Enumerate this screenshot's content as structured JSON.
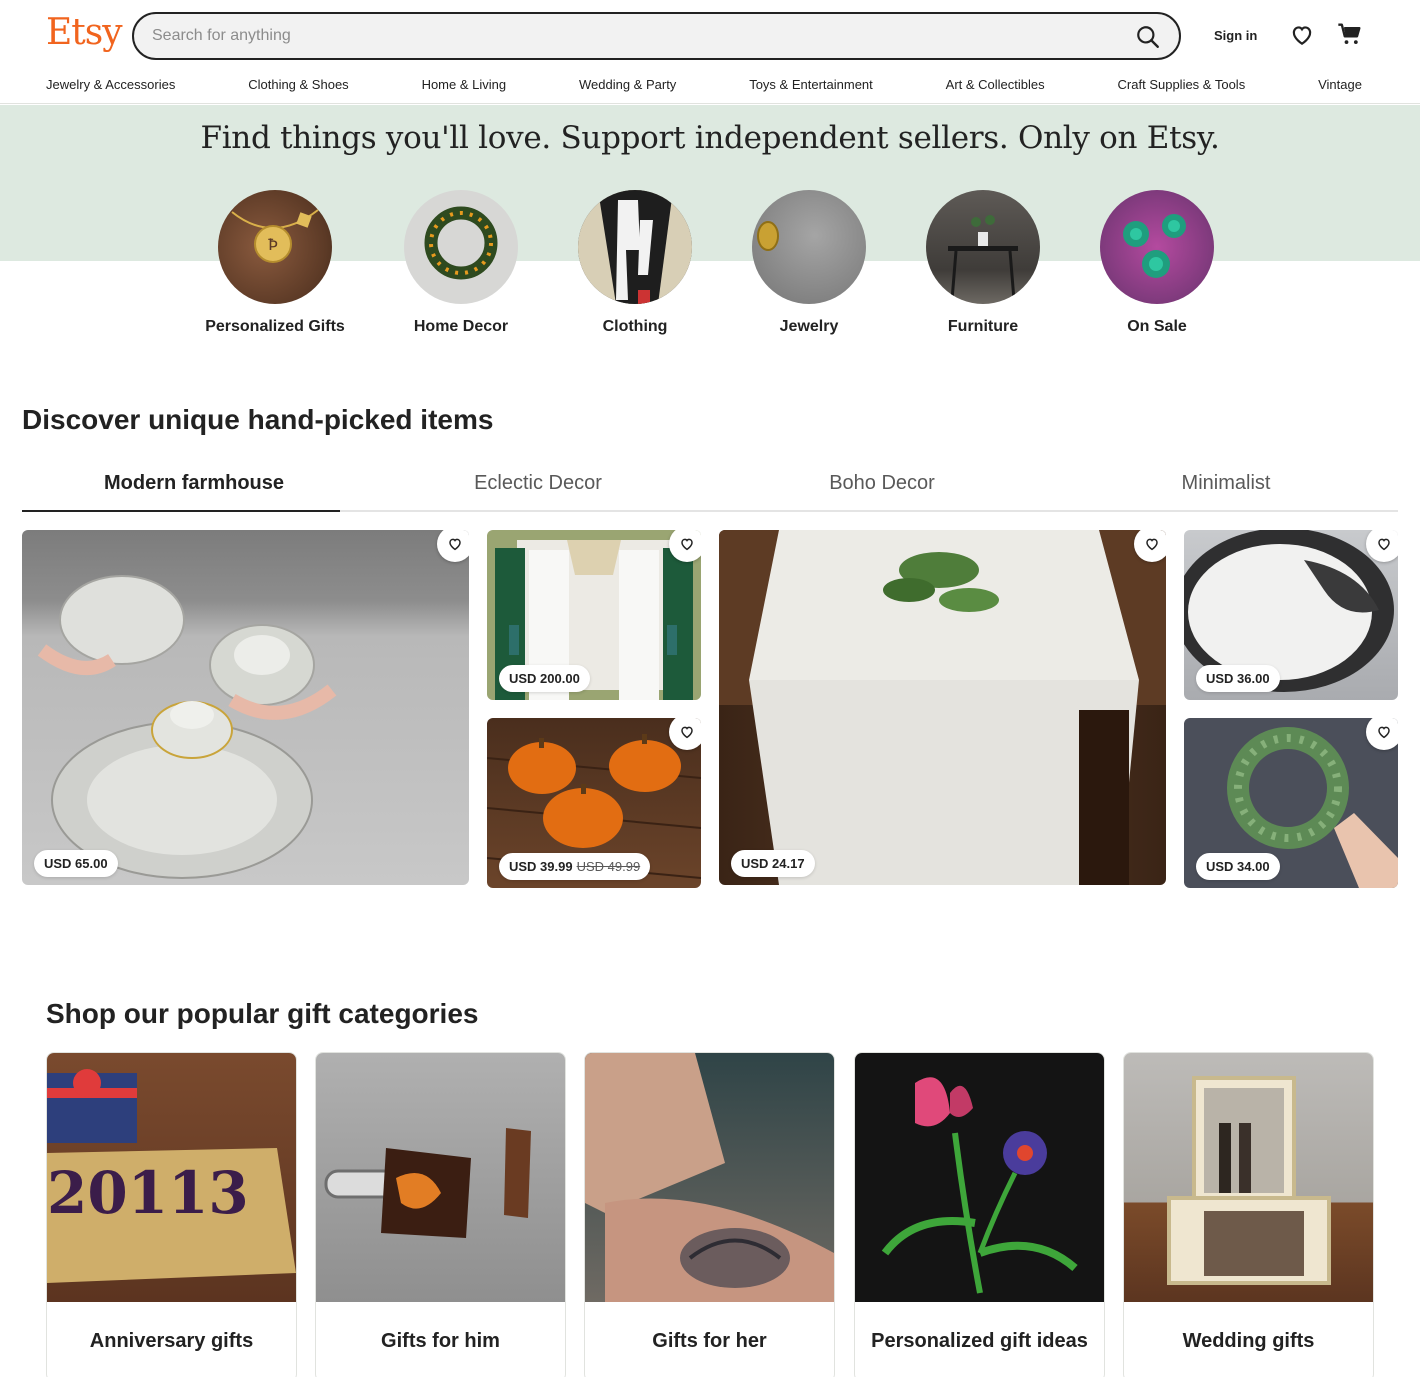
{
  "header": {
    "logo": "Etsy",
    "search_placeholder": "Search for anything",
    "sign_in": "Sign in",
    "nav": [
      "Jewelry & Accessories",
      "Clothing & Shoes",
      "Home & Living",
      "Wedding & Party",
      "Toys & Entertainment",
      "Art & Collectibles",
      "Craft Supplies & Tools",
      "Vintage"
    ]
  },
  "hero": {
    "title": "Find things you'll love. Support independent sellers. Only on Etsy.",
    "categories": [
      "Personalized Gifts",
      "Home Decor",
      "Clothing",
      "Jewelry",
      "Furniture",
      "On Sale"
    ]
  },
  "discover": {
    "title": "Discover unique hand-picked items",
    "tabs": [
      "Modern farmhouse",
      "Eclectic Decor",
      "Boho Decor",
      "Minimalist"
    ],
    "active_tab": "Modern farmhouse",
    "items": [
      {
        "price": "USD 65.00"
      },
      {
        "price": "USD 200.00"
      },
      {
        "price": "USD 39.99",
        "original_price": "USD 49.99"
      },
      {
        "price": "USD 24.17"
      },
      {
        "price": "USD 36.00"
      },
      {
        "price": "USD 34.00"
      }
    ]
  },
  "gifts": {
    "title": "Shop our popular gift categories",
    "items": [
      "Anniversary gifts",
      "Gifts for him",
      "Gifts for her",
      "Personalized gift ideas",
      "Wedding gifts"
    ],
    "anniversary_card_text": "20113"
  },
  "colors": {
    "brand": "#f1641e",
    "hero_band": "#dde9e0"
  }
}
